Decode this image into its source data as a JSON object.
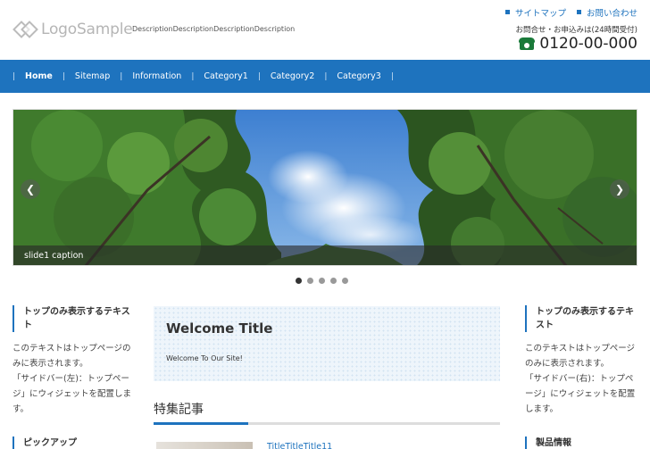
{
  "header": {
    "logo_text": "LogoSample",
    "description": "DescriptionDescriptionDescriptionDescription",
    "links": [
      "サイトマップ",
      "お問い合わせ"
    ],
    "contact_note": "お問合せ・お申込みは(24時間受付)",
    "phone": "0120-00-000"
  },
  "nav": {
    "items": [
      "Home",
      "Sitemap",
      "Information",
      "Category1",
      "Category2",
      "Category3"
    ],
    "active": "Home"
  },
  "slider": {
    "caption": "slide1 caption",
    "dots": 5,
    "active_dot": 1
  },
  "left_sidebar": {
    "widget1_title": "トップのみ表示するテキスト",
    "widget1_text": [
      "このテキストはトップページのみに表示されます。",
      "「サイドバー(左)：トップページ」にウィジェットを配置します。"
    ],
    "widget2_title": "ピックアップ"
  },
  "right_sidebar": {
    "widget1_title": "トップのみ表示するテキスト",
    "widget1_text": [
      "このテキストはトップページのみに表示されます。",
      "「サイドバー(右)：トップページ」にウィジェットを配置します。"
    ],
    "widget2_title": "製品情報"
  },
  "main": {
    "welcome_title": "Welcome Title",
    "welcome_text": "Welcome To Our Site!",
    "feature_title": "特集記事",
    "article_title": "TitleTitleTitle11"
  },
  "colors": {
    "accent": "#1e73be",
    "phone_icon": "#1a7a3a"
  }
}
